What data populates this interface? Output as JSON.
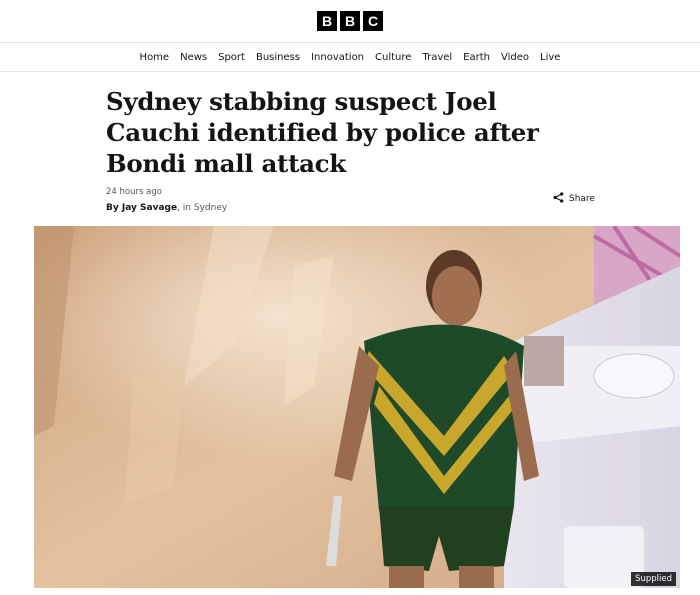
{
  "brand": {
    "letters": [
      "B",
      "B",
      "C"
    ]
  },
  "nav": {
    "items": [
      "Home",
      "News",
      "Sport",
      "Business",
      "Innovation",
      "Culture",
      "Travel",
      "Earth",
      "Video",
      "Live"
    ]
  },
  "article": {
    "headline": "Sydney stabbing suspect Joel Cauchi identified by police after Bondi mall attack",
    "timestamp": "24 hours ago",
    "author_prefix": "By ",
    "author": "Jay Savage",
    "location": "in Sydney",
    "share_label": "Share",
    "image_credit": "Supplied"
  },
  "colors": {
    "brand_black": "#000000",
    "text": "#141414",
    "muted": "#545658"
  }
}
